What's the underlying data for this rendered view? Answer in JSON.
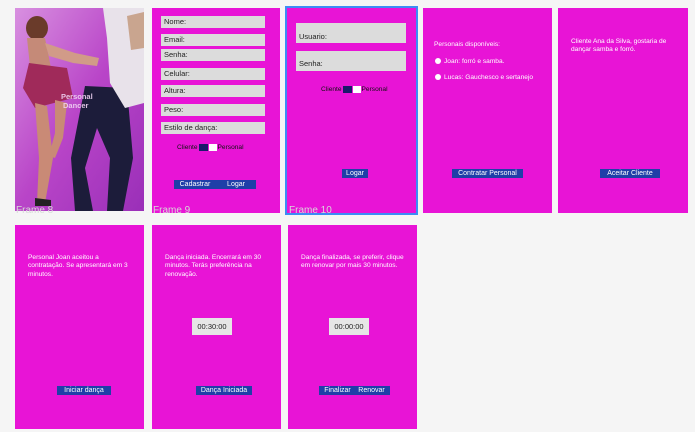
{
  "frames": {
    "f8": {
      "label": "Frame 8",
      "logo_line1": "Personal",
      "logo_line2": "Dancer"
    },
    "f9": {
      "label": "Frame 9",
      "fields": [
        "Nome:",
        "Email:",
        "Senha:",
        "Celular:",
        "Altura:",
        "Peso:",
        "Estilo de dança:"
      ],
      "toggle_left": "Cliente",
      "toggle_right": "Personal",
      "btn_cadastrar": "Cadastrar",
      "btn_logar": "Logar"
    },
    "f10": {
      "label": "Frame 10",
      "usuario": "Usuario:",
      "senha": "Senha:",
      "toggle_left": "Cliente",
      "toggle_right": "Personal",
      "btn_logar": "Logar"
    },
    "f11": {
      "title": "Personais disponíveis:",
      "items": [
        "Joan: forró e samba.",
        "Lucas: Gauchesco e sertanejo"
      ],
      "btn": "Contratar Personal"
    },
    "f12": {
      "text": "Cliente Ana da Silva, gostaria de dançar samba e forró.",
      "btn": "Aceitar Cliente"
    },
    "f13": {
      "text": "Personal Joan aceitou a contratação. Se apresentará em 3 minutos.",
      "btn": "Iniciar dança"
    },
    "f14": {
      "text": "Dança iniciada. Encerrará em 30 minutos. Terás preferência na renovação.",
      "timer": "00:30:00",
      "btn": "Dança Iniciada"
    },
    "f15": {
      "text": "Dança finalizada, se preferir, clique em renovar por mais 30 minutos.",
      "timer": "00:00:00",
      "btn_finalizar": "Finalizar",
      "btn_renovar": "Renovar"
    }
  },
  "colors": {
    "frame": "#e814d6",
    "button": "#1f3fa8",
    "selection": "#3b8cf5",
    "background": "#f5f5f5"
  }
}
